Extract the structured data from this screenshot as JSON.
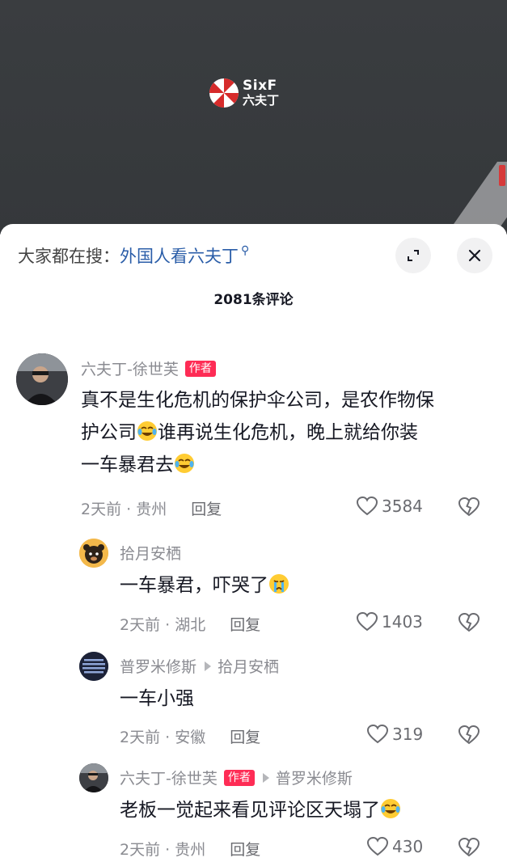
{
  "video": {
    "logo_line1": "SixF",
    "logo_line2": "六夫丁"
  },
  "sheet": {
    "search_prefix": "大家都在搜：",
    "search_query": "外国人看六夫丁",
    "comment_count": "2081条评论"
  },
  "colors": {
    "author_badge": "#fe2c55",
    "search_link": "#2a5da8",
    "meta_gray": "#8a8b91"
  },
  "comments": [
    {
      "name": "六夫丁-徐世芙",
      "badge": "作者",
      "text_1": "真不是生化危机的保护伞公司，是农作物保",
      "text_2a": "护公司",
      "text_2b": "谁再说生化危机，晚上就给你装",
      "text_3": "一车暴君去",
      "time_loc": "2天前 · 贵州",
      "reply": "回复",
      "likes": "3584"
    },
    {
      "name": "拾月安栖",
      "text": "一车暴君，吓哭了",
      "time_loc": "2天前 · 湖北",
      "reply": "回复",
      "likes": "1403"
    },
    {
      "name": "普罗米修斯",
      "reply_to": "拾月安栖",
      "text": "一车小强",
      "time_loc": "2天前 · 安徽",
      "reply": "回复",
      "likes": "319"
    },
    {
      "name": "六夫丁-徐世芙",
      "badge": "作者",
      "reply_to": "普罗米修斯",
      "text": "老板一觉起来看见评论区天塌了",
      "time_loc": "2天前 · 贵州",
      "reply": "回复",
      "likes": "430"
    }
  ]
}
